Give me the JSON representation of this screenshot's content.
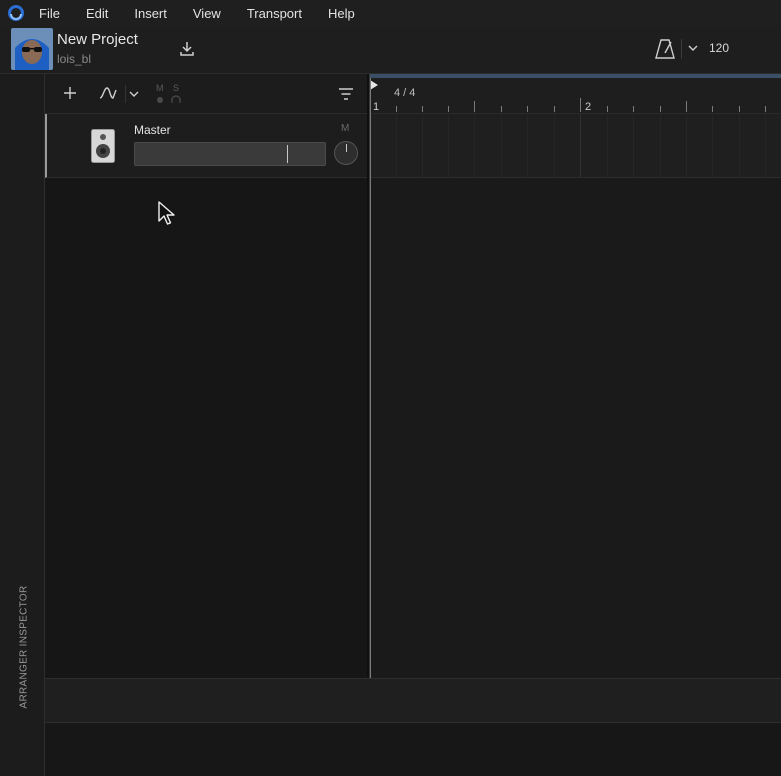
{
  "menu": {
    "items": [
      "File",
      "Edit",
      "Insert",
      "View",
      "Transport",
      "Help"
    ]
  },
  "project": {
    "title": "New Project",
    "user": "lois_bl"
  },
  "transport": {
    "tempo": "120"
  },
  "sidebar": {
    "label": "ARRANGER INSPECTOR"
  },
  "track_toolbar": {
    "mute_label": "M",
    "solo_label": "S"
  },
  "tracks": [
    {
      "name": "Master",
      "mute_label": "M",
      "volume_fraction": 0.79
    }
  ],
  "timeline": {
    "time_signature": "4 / 4",
    "bars": [
      "1",
      "2"
    ]
  },
  "colors": {
    "accent": "#3a5066",
    "background": "#1b1b1b",
    "panel": "#161616"
  },
  "icons": [
    "app-logo-icon",
    "download-icon",
    "metronome-icon",
    "chevron-down-icon",
    "add-icon",
    "automation-curve-icon",
    "filter-icon",
    "speaker-icon",
    "headphones-icon",
    "cursor-icon"
  ]
}
